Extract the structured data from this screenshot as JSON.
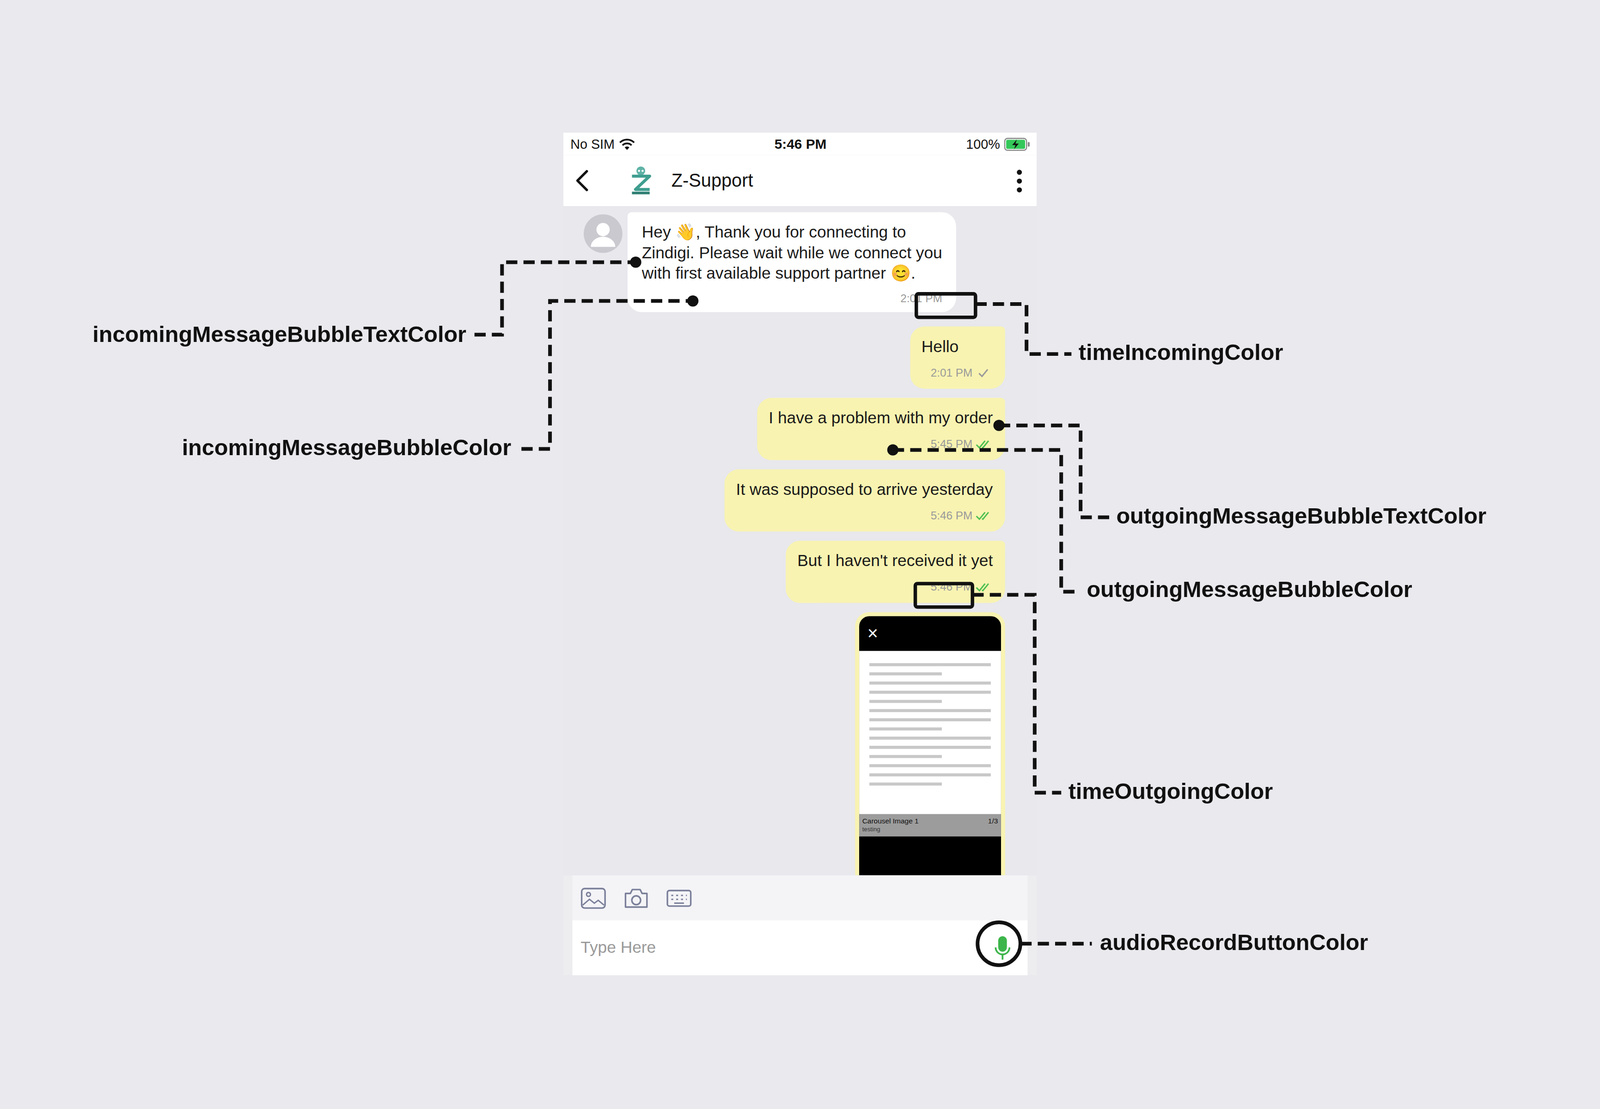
{
  "status_bar": {
    "carrier": "No SIM",
    "time": "5:46 PM",
    "battery": "100%",
    "battery_level": 1,
    "charging": true
  },
  "header": {
    "title": "Z-Support"
  },
  "messages": [
    {
      "kind": "incoming",
      "lines": [
        "Hey 👋, Thank you for connecting to",
        "Zindigi. Please wait while we connect you",
        "with first available support partner 😊."
      ],
      "time": "2:01 PM"
    },
    {
      "kind": "outgoing",
      "text": "Hello",
      "time": "2:01 PM",
      "read": false
    },
    {
      "kind": "outgoing",
      "text": "I have a problem with my order",
      "time": "5:45 PM",
      "read": true
    },
    {
      "kind": "outgoing",
      "text": "It was supposed to arrive yesterday",
      "time": "5:46 PM",
      "read": true
    },
    {
      "kind": "outgoing",
      "text": "But I haven't received it yet",
      "time": "5:46 PM",
      "read": true
    },
    {
      "kind": "image",
      "close": "×",
      "caption": "Carousel Image 1",
      "subcaption": "testing",
      "counter": "1/3"
    }
  ],
  "composer": {
    "placeholder": "Type Here"
  },
  "annotations": [
    {
      "label": "incomingMessageBubbleTextColor",
      "kind": "dot"
    },
    {
      "label": "incomingMessageBubbleColor",
      "kind": "dot"
    },
    {
      "label": "timeIncomingColor",
      "kind": "box"
    },
    {
      "label": "outgoingMessageBubbleTextColor",
      "kind": "dot"
    },
    {
      "label": "outgoingMessageBubbleColor",
      "kind": "dot"
    },
    {
      "label": "timeOutgoingColor",
      "kind": "box"
    },
    {
      "label": "audioRecordButtonColor",
      "kind": "ring"
    }
  ]
}
